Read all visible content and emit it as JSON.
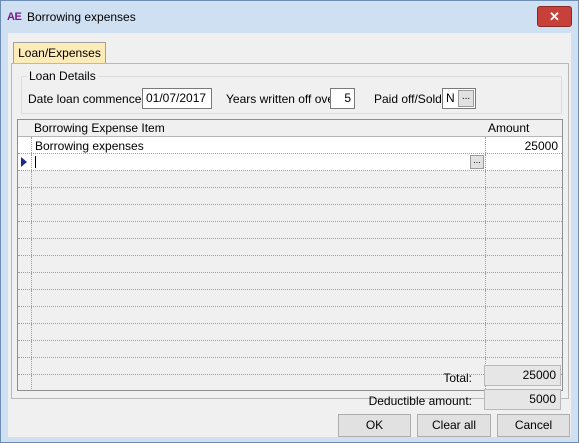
{
  "window": {
    "app_icon": "AE",
    "title": "Borrowing expenses",
    "close_glyph": "✕"
  },
  "tabs": [
    {
      "label": "Loan/Expenses",
      "selected": true
    }
  ],
  "loan_details": {
    "legend": "Loan Details",
    "date_label": "Date loan commenced",
    "date_value": "01/07/2017",
    "years_label": "Years written off over",
    "years_value": "5",
    "paid_label": "Paid off/Sold",
    "paid_value": "N",
    "paid_button": "..."
  },
  "grid": {
    "columns": [
      "Borrowing Expense Item",
      "Amount"
    ],
    "rows": [
      {
        "item": "Borrowing expenses",
        "amount": "25000"
      }
    ],
    "new_row_button": "..."
  },
  "totals": {
    "total_label": "Total:",
    "total_value": "25000",
    "deductible_label": "Deductible amount:",
    "deductible_value": "5000"
  },
  "buttons": {
    "ok": "OK",
    "clear_all": "Clear all",
    "cancel": "Cancel"
  },
  "colors": {
    "window_frame": "#cfe0f3",
    "tab_selected": "#fdebb8",
    "close_button": "#c7403a",
    "app_icon": "#7a1a8c"
  }
}
